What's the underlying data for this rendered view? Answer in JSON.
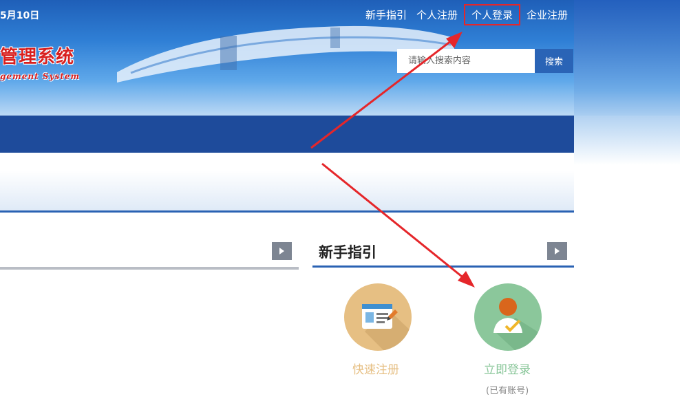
{
  "header": {
    "date_text": "5月10日",
    "logo_cn": "管理系统",
    "logo_en": "gement  System"
  },
  "topnav": {
    "items": [
      {
        "label": "新手指引"
      },
      {
        "label": "个人注册"
      },
      {
        "label": "个人登录"
      },
      {
        "label": "企业注册"
      }
    ]
  },
  "search": {
    "placeholder": "请输入搜索内容",
    "button_label": "搜索"
  },
  "guide": {
    "title": "新手指引",
    "register_label": "快速注册",
    "login_label": "立即登录",
    "login_note": "(已有账号)"
  },
  "colors": {
    "navbar": "#1e4b9b",
    "highlight_box": "#e5262a",
    "annotation_arrow": "#e5262a",
    "register_circle": "#e6bf83",
    "login_circle": "#8bc79b"
  },
  "icons": [
    "registration-card-icon",
    "user-check-icon",
    "chevron-right-icon"
  ]
}
